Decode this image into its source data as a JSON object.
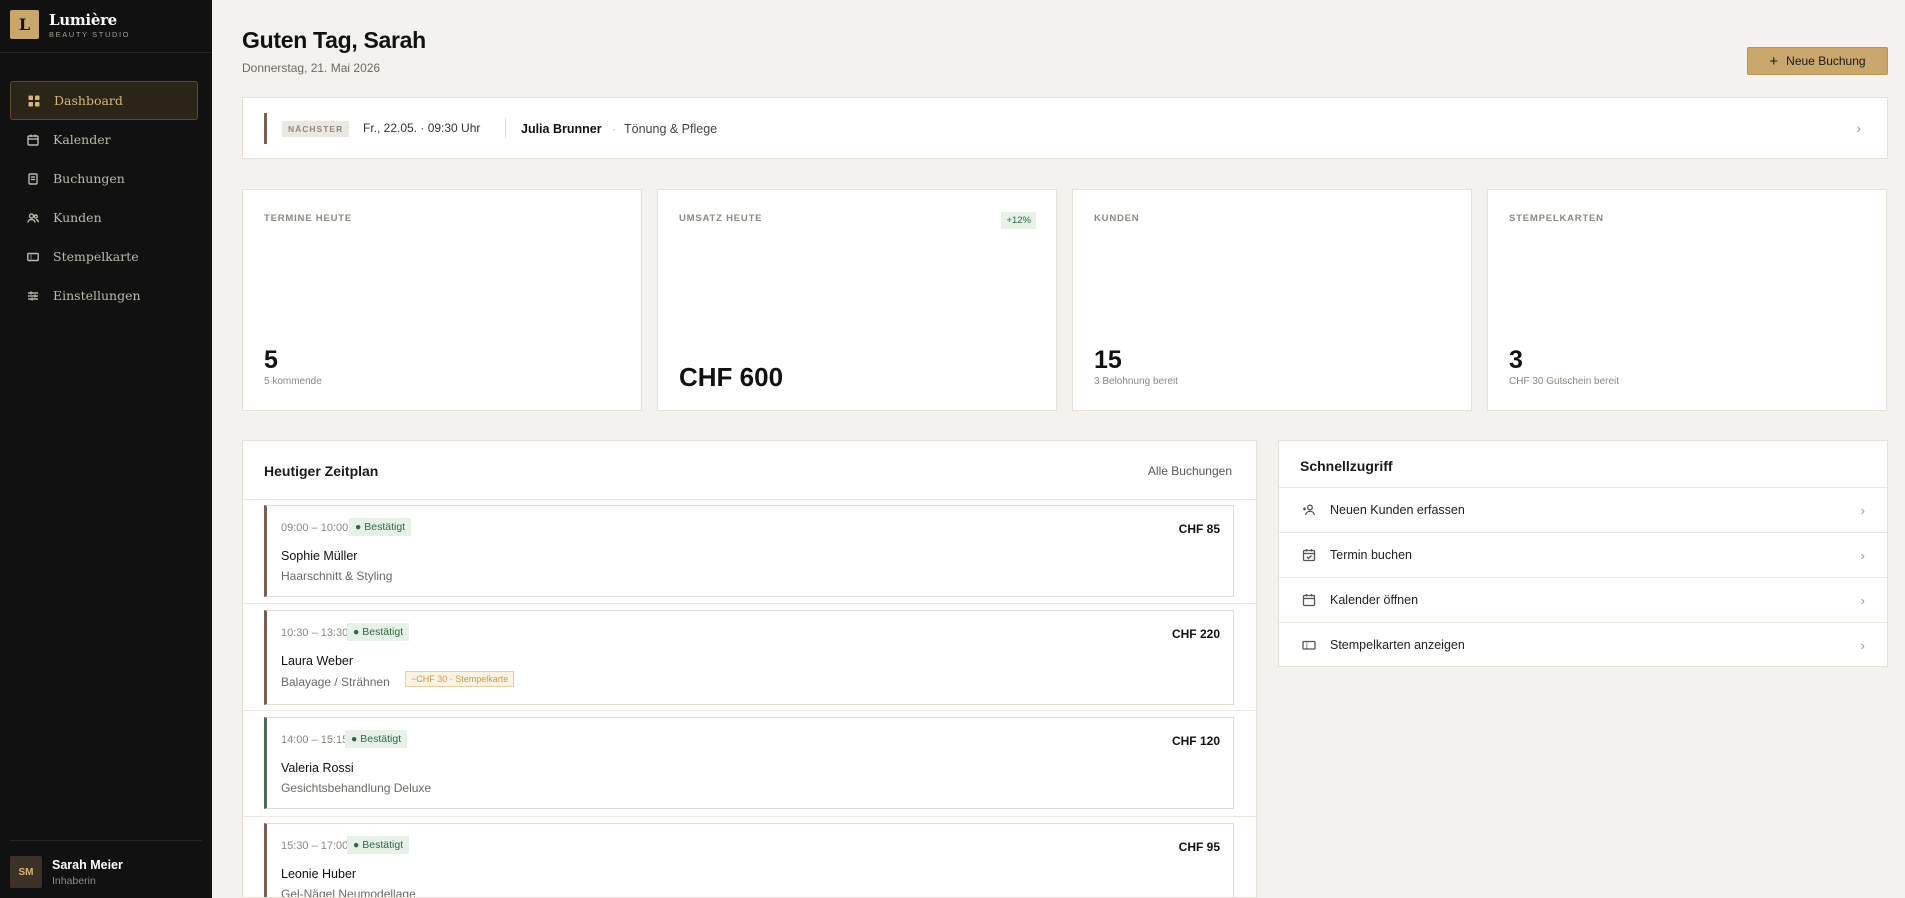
{
  "brand": {
    "logo_letter": "L",
    "name": "Lumière",
    "tagline": "BEAUTY STUDIO"
  },
  "nav": [
    {
      "label": "Dashboard",
      "icon": "grid-icon",
      "active": true
    },
    {
      "label": "Kalender",
      "icon": "calendar-icon",
      "active": false
    },
    {
      "label": "Buchungen",
      "icon": "booking-icon",
      "active": false
    },
    {
      "label": "Kunden",
      "icon": "users-icon",
      "active": false
    },
    {
      "label": "Stempelkarte",
      "icon": "ticket-icon",
      "active": false
    },
    {
      "label": "Einstellungen",
      "icon": "sliders-icon",
      "active": false
    }
  ],
  "user": {
    "initials": "SM",
    "name": "Sarah Meier",
    "role": "Inhaberin"
  },
  "header": {
    "greeting": "Guten Tag, Sarah",
    "date": "Donnerstag, 21. Mai 2026",
    "new_booking_label": "Neue Buchung"
  },
  "next": {
    "badge": "NÄCHSTER",
    "time": "Fr., 22.05. · 09:30 Uhr",
    "client": "Julia Brunner",
    "separator": "·",
    "service": "Tönung & Pflege"
  },
  "stats": [
    {
      "label": "TERMINE HEUTE",
      "value": "5",
      "sub": "5 kommende",
      "badge": ""
    },
    {
      "label": "UMSATZ HEUTE",
      "value": "CHF 600",
      "sub": "",
      "badge": "+12%"
    },
    {
      "label": "KUNDEN",
      "value": "15",
      "sub": "3 Belohnung bereit",
      "badge": ""
    },
    {
      "label": "STEMPELKARTEN",
      "value": "3",
      "sub": "CHF 30 Gutschein bereit",
      "badge": ""
    }
  ],
  "schedule": {
    "title": "Heutiger Zeitplan",
    "link": "Alle Buchungen",
    "items": [
      {
        "time": "09:00 – 10:00",
        "status": "● Bestätigt",
        "name": "Sophie Müller",
        "service": "Haarschnitt & Styling",
        "price": "CHF 85",
        "tag": ""
      },
      {
        "time": "10:30 – 13:30",
        "status": "● Bestätigt",
        "name": "Laura Weber",
        "service": "Balayage / Strähnen",
        "price": "CHF 220",
        "tag": "−CHF 30 · Stempelkarte"
      },
      {
        "time": "14:00 – 15:15",
        "status": "● Bestätigt",
        "name": "Valeria Rossi",
        "service": "Gesichtsbehandlung Deluxe",
        "price": "CHF 120",
        "tag": ""
      },
      {
        "time": "15:30 – 17:00",
        "status": "● Bestätigt",
        "name": "Leonie Huber",
        "service": "Gel-Nägel Neumodellage",
        "price": "CHF 95",
        "tag": ""
      }
    ]
  },
  "quick": {
    "title": "Schnellzugriff",
    "items": [
      {
        "label": "Neuen Kunden erfassen",
        "icon": "user-plus-icon"
      },
      {
        "label": "Termin buchen",
        "icon": "calendar-check-icon"
      },
      {
        "label": "Kalender öffnen",
        "icon": "calendar-grid-icon"
      },
      {
        "label": "Stempelkarten anzeigen",
        "icon": "ticket-icon"
      }
    ]
  },
  "colors": {
    "accent": "#c9a66b",
    "sidebar": "#111111",
    "background": "#f4f2ee",
    "success": "#2f6b42"
  }
}
